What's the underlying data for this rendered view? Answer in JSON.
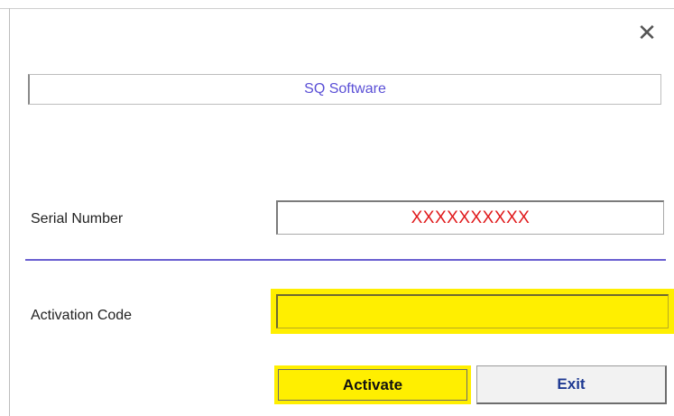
{
  "window": {
    "close_icon": "close-icon",
    "close_glyph": "✕"
  },
  "header": {
    "title": "SQ Software"
  },
  "form": {
    "serial_label": "Serial Number",
    "serial_value": "XXXXXXXXXX",
    "activation_label": "Activation Code",
    "activation_value": ""
  },
  "buttons": {
    "activate_label": "Activate",
    "exit_label": "Exit"
  },
  "colors": {
    "highlight_yellow": "#ffef00",
    "serial_text_red": "#e0191b",
    "title_blue": "#5a4fd6",
    "divider_purple": "#6a5fd1"
  }
}
